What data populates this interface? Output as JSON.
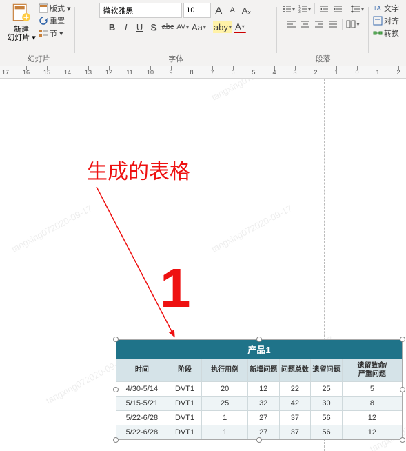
{
  "ribbon": {
    "slides": {
      "new_label_1": "新建",
      "new_label_2": "幻灯片 ▾",
      "layout": "版式 ▾",
      "reset": "重置",
      "section": "节 ▾",
      "group_label": "幻灯片"
    },
    "font": {
      "name": "微软雅黑",
      "size": "10",
      "grow": "A",
      "shrink": "A",
      "clear": "Aₓ",
      "B": "B",
      "I": "I",
      "U": "U",
      "S": "S",
      "abc": "abc",
      "AV": "AV",
      "abc2": "Aa",
      "hilite": "aby",
      "color": "A",
      "group_label": "字体"
    },
    "para": {
      "group_label": "段落",
      "textdir": "文字",
      "align": "对齐",
      "convert": "转换"
    }
  },
  "ruler": {
    "nums": [
      "17",
      "16",
      "15",
      "14",
      "13",
      "12",
      "11",
      "10",
      "9",
      "8",
      "7",
      "6",
      "5",
      "4",
      "3",
      "2",
      "1",
      "0",
      "1",
      "2"
    ]
  },
  "annotation": {
    "label": "生成的表格",
    "num": "1"
  },
  "watermark": "tangxing072020-09-17",
  "table": {
    "title": "产品1",
    "headers": [
      "时间",
      "阶段",
      "执行用例",
      "新增问题",
      "问题总数",
      "遗留问题",
      "遗留致命/严重问题"
    ],
    "rows": [
      [
        "4/30-5/14",
        "DVT1",
        "20",
        "12",
        "22",
        "25",
        "5"
      ],
      [
        "5/15-5/21",
        "DVT1",
        "25",
        "32",
        "42",
        "30",
        "8"
      ],
      [
        "5/22-6/28",
        "DVT1",
        "1",
        "27",
        "37",
        "56",
        "12"
      ],
      [
        "5/22-6/28",
        "DVT1",
        "1",
        "27",
        "37",
        "56",
        "12"
      ]
    ]
  },
  "chart_data": {
    "type": "table",
    "title": "产品1",
    "columns": [
      "时间",
      "阶段",
      "执行用例",
      "新增问题",
      "问题总数",
      "遗留问题",
      "遗留致命/严重问题"
    ],
    "rows": [
      {
        "时间": "4/30-5/14",
        "阶段": "DVT1",
        "执行用例": 20,
        "新增问题": 12,
        "问题总数": 22,
        "遗留问题": 25,
        "遗留致命/严重问题": 5
      },
      {
        "时间": "5/15-5/21",
        "阶段": "DVT1",
        "执行用例": 25,
        "新增问题": 32,
        "问题总数": 42,
        "遗留问题": 30,
        "遗留致命/严重问题": 8
      },
      {
        "时间": "5/22-6/28",
        "阶段": "DVT1",
        "执行用例": 1,
        "新增问题": 27,
        "问题总数": 37,
        "遗留问题": 56,
        "遗留致命/严重问题": 12
      },
      {
        "时间": "5/22-6/28",
        "阶段": "DVT1",
        "执行用例": 1,
        "新增问题": 27,
        "问题总数": 37,
        "遗留问题": 56,
        "遗留致命/严重问题": 12
      }
    ]
  }
}
